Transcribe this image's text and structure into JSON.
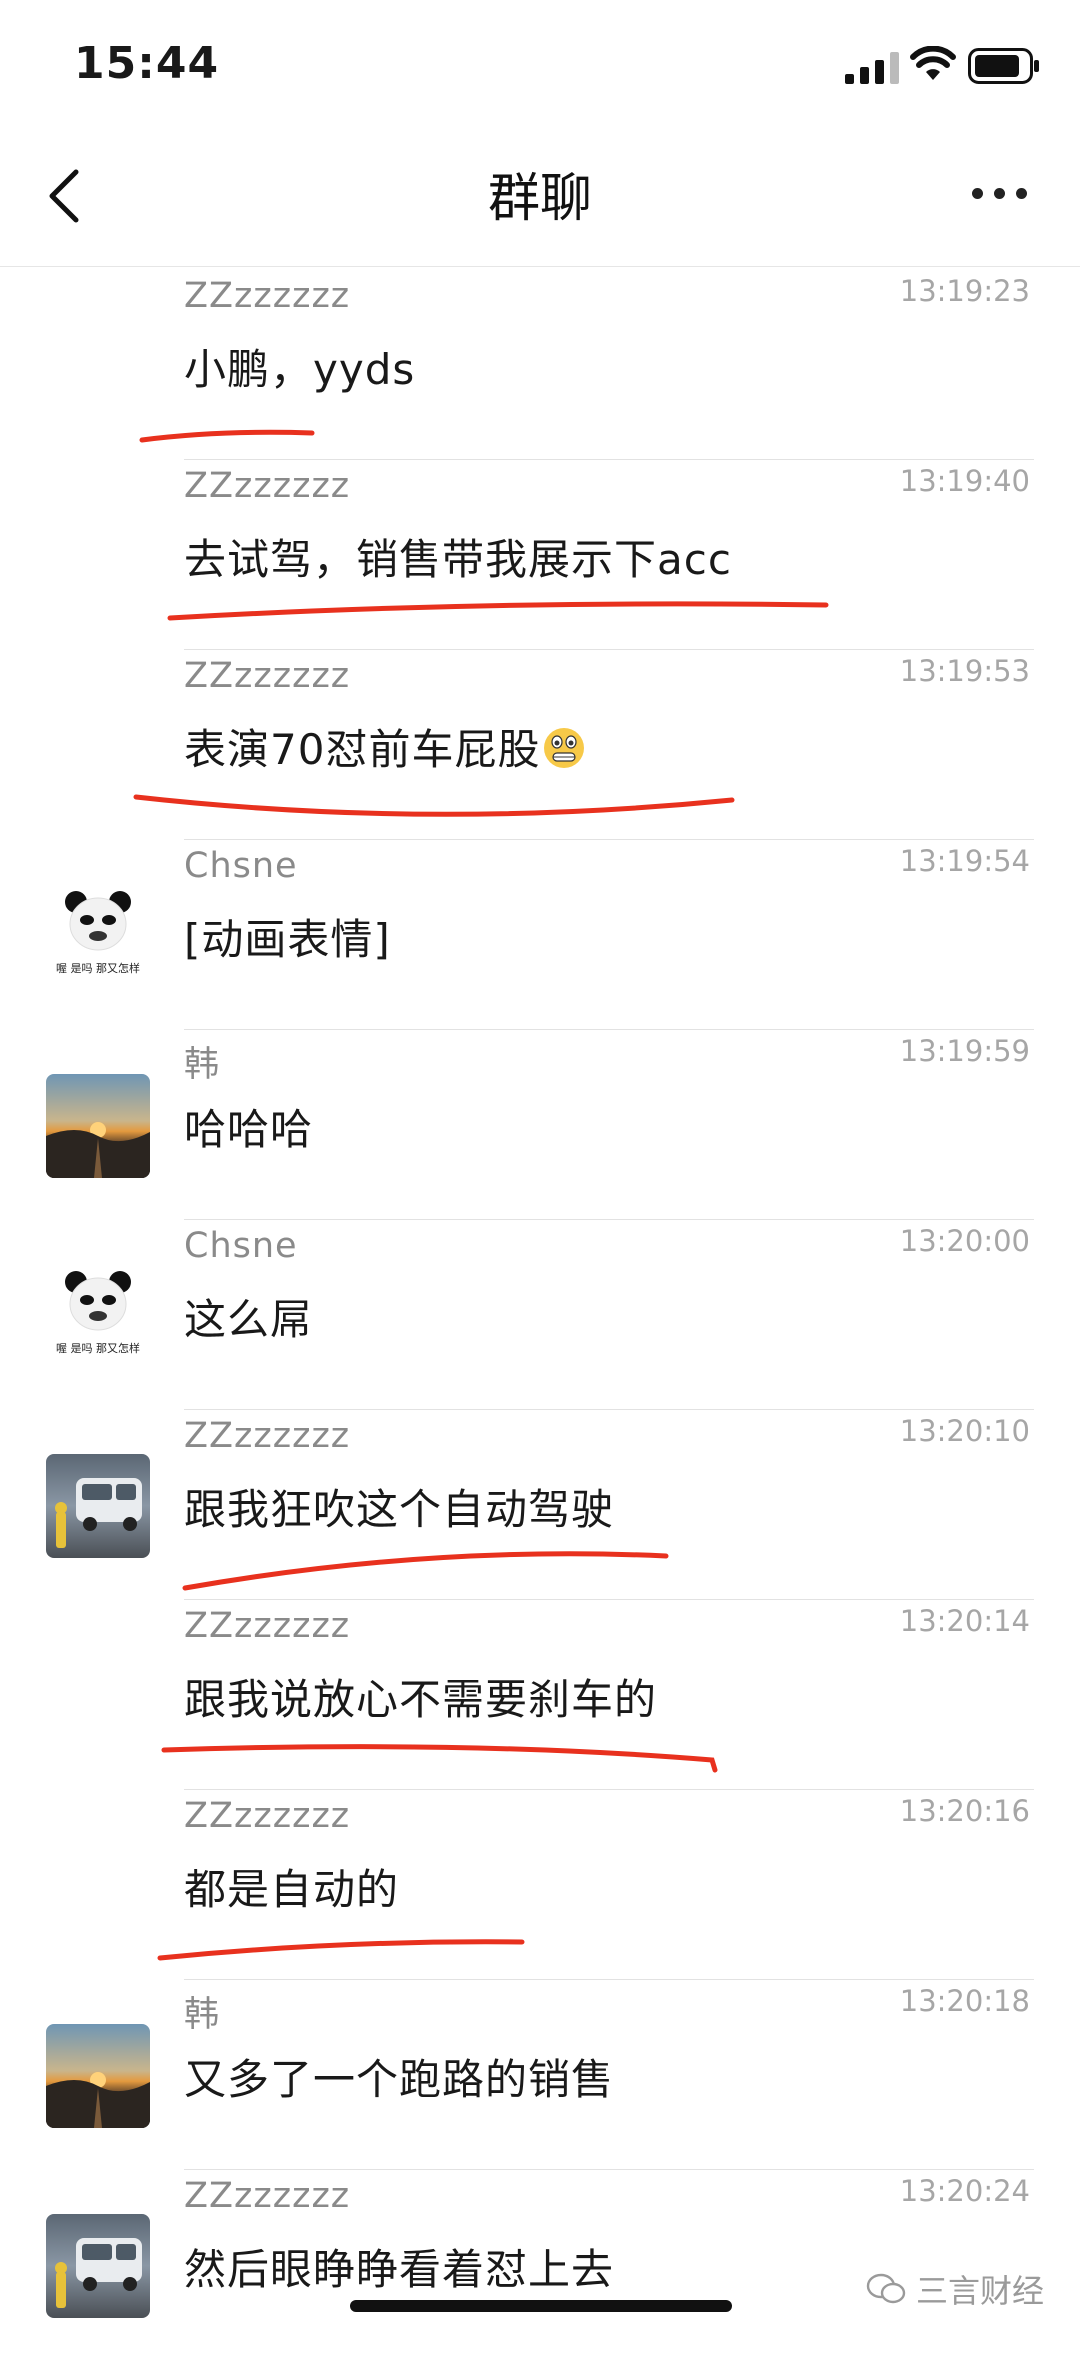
{
  "status_bar": {
    "time": "15:44"
  },
  "header": {
    "title": "群聊"
  },
  "messages": [
    {
      "sender": "ZZzzzzzz",
      "time": "13:19:23",
      "text": "小鹏，yyds",
      "avatar": ""
    },
    {
      "sender": "ZZzzzzzz",
      "time": "13:19:40",
      "text": "去试驾，销售带我展示下acc",
      "avatar": ""
    },
    {
      "sender": "ZZzzzzzz",
      "time": "13:19:53",
      "text": "表演70怼前车屁股",
      "avatar": "",
      "emoji": "grimacing-face-emoji"
    },
    {
      "sender": "Chsne",
      "time": "13:19:54",
      "text": "[动画表情]",
      "avatar": "panda-meme"
    },
    {
      "sender": "韩",
      "time": "13:19:59",
      "text": "哈哈哈",
      "avatar": "sunset-landscape"
    },
    {
      "sender": "Chsne",
      "time": "13:20:00",
      "text": "这么屌",
      "avatar": "panda-meme"
    },
    {
      "sender": "ZZzzzzzz",
      "time": "13:20:10",
      "text": "跟我狂吹这个自动驾驶",
      "avatar": "van-photo"
    },
    {
      "sender": "ZZzzzzzz",
      "time": "13:20:14",
      "text": "跟我说放心不需要刹车的",
      "avatar": ""
    },
    {
      "sender": "ZZzzzzzz",
      "time": "13:20:16",
      "text": "都是自动的",
      "avatar": ""
    },
    {
      "sender": "韩",
      "time": "13:20:18",
      "text": "又多了一个跑路的销售",
      "avatar": "sunset-landscape"
    },
    {
      "sender": "ZZzzzzzz",
      "time": "13:20:24",
      "text": "然后眼睁睁看着怼上去",
      "avatar": "van-photo"
    }
  ],
  "panda_caption": "喔 是吗 那又怎样",
  "watermark": {
    "label": "三言财经"
  },
  "colors": {
    "annotation": "#e8311e",
    "text": "#191919",
    "meta": "#8a8a8a"
  }
}
